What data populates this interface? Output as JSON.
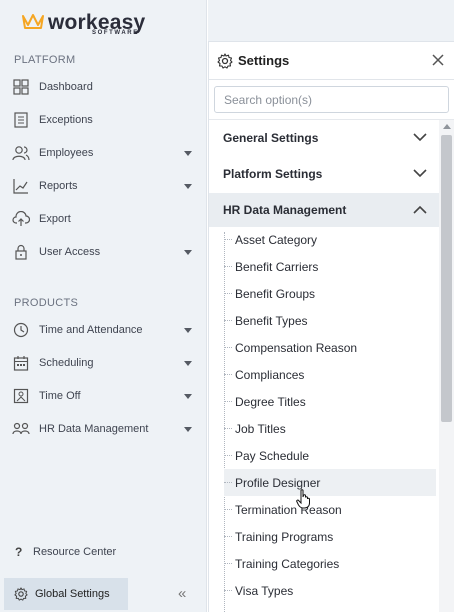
{
  "brand": {
    "name": "workeasy",
    "sub": "SOFTWARE",
    "accent": "#f5a623"
  },
  "sidebar": {
    "platform_title": "PLATFORM",
    "platform_items": [
      {
        "label": "Dashboard",
        "icon": "grid-icon",
        "has_caret": false
      },
      {
        "label": "Exceptions",
        "icon": "list-icon",
        "has_caret": false
      },
      {
        "label": "Employees",
        "icon": "users-icon",
        "has_caret": true
      },
      {
        "label": "Reports",
        "icon": "chart-icon",
        "has_caret": true
      },
      {
        "label": "Export",
        "icon": "cloud-upload-icon",
        "has_caret": false
      },
      {
        "label": "User Access",
        "icon": "lock-icon",
        "has_caret": true
      }
    ],
    "products_title": "PRODUCTS",
    "product_items": [
      {
        "label": "Time and Attendance",
        "icon": "clock-icon",
        "has_caret": true
      },
      {
        "label": "Scheduling",
        "icon": "calendar-icon",
        "has_caret": true
      },
      {
        "label": "Time Off",
        "icon": "time-off-icon",
        "has_caret": true
      },
      {
        "label": "HR Data Management",
        "icon": "hr-users-icon",
        "has_caret": true
      }
    ],
    "resource_center": "Resource Center",
    "resource_icon": "?",
    "global_settings": "Global Settings"
  },
  "settings": {
    "title": "Settings",
    "search_placeholder": "Search option(s)",
    "sections": [
      {
        "label": "General Settings",
        "open": false
      },
      {
        "label": "Platform Settings",
        "open": false
      },
      {
        "label": "HR Data Management",
        "open": true
      }
    ],
    "hr_items": [
      "Asset Category",
      "Benefit Carriers",
      "Benefit Groups",
      "Benefit Types",
      "Compensation Reason",
      "Compliances",
      "Degree Titles",
      "Job Titles",
      "Pay Schedule",
      "Profile Designer",
      "Termination Reason",
      "Training Programs",
      "Training Categories",
      "Visa Types"
    ],
    "hovered_item": "Profile Designer"
  }
}
